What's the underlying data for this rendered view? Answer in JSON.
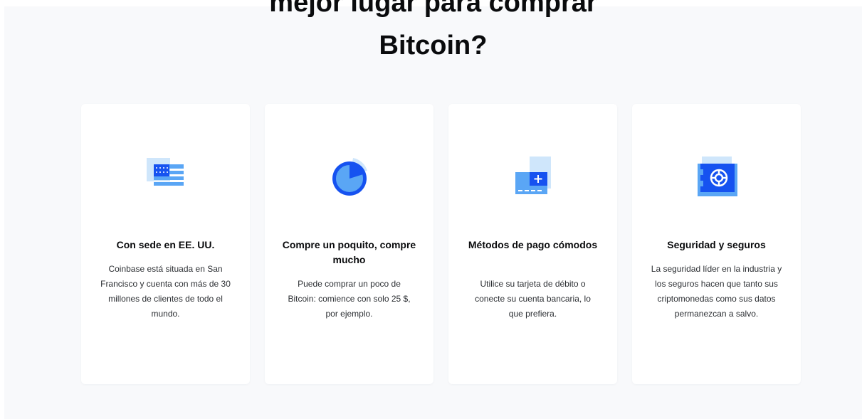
{
  "heading": {
    "line1": "mejor lugar para comprar",
    "line2": "Bitcoin?"
  },
  "features": [
    {
      "icon": "us-flag-icon",
      "title": "Con sede en EE. UU.",
      "text": "Coinbase está situada en San Francisco y cuenta con más de 30 millones de clientes de todo el mundo."
    },
    {
      "icon": "pie-timer-icon",
      "title": "Compre un poquito, compre mucho",
      "text": "Puede comprar un poco de Bitcoin: comience con solo 25 $, por ejemplo."
    },
    {
      "icon": "payment-card-icon",
      "title": "Métodos de pago cómodos",
      "text": "Utilice su tarjeta de débito o conecte su cuenta bancaria, lo que prefiera."
    },
    {
      "icon": "safe-vault-icon",
      "title": "Seguridad y seguros",
      "text": "La seguridad líder en la industria y los seguros hacen que tanto sus criptomonedas como sus datos permanezcan a salvo."
    }
  ],
  "colors": {
    "section_background": "#f8f9fb",
    "card_background": "#ffffff",
    "heading_text": "#0a0b0d",
    "icon_blue": "#1652f0",
    "icon_light_blue": "#5aa6f5",
    "icon_pale_blue": "#cfe6fb"
  }
}
